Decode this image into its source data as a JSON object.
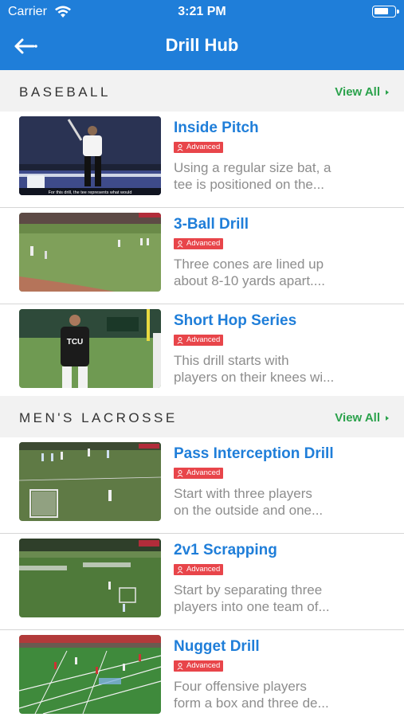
{
  "status": {
    "carrier": "Carrier",
    "time": "3:21 PM"
  },
  "nav": {
    "title": "Drill Hub"
  },
  "sections": [
    {
      "title": "BASEBALL",
      "view_all": "View All",
      "items": [
        {
          "title": "Inside Pitch",
          "badge": "Advanced",
          "desc_line1": "Using a regular size bat, a",
          "desc_line2": "tee is positioned on the...",
          "caption": "For this drill, the tee represents what would"
        },
        {
          "title": "3-Ball Drill",
          "badge": "Advanced",
          "desc_line1": "Three cones are lined up",
          "desc_line2": "about 8-10 yards apart...."
        },
        {
          "title": "Short Hop Series",
          "badge": "Advanced",
          "desc_line1": "This drill starts with",
          "desc_line2": "players on their knees wi...",
          "shirt_text": "TCU"
        }
      ]
    },
    {
      "title": "MEN'S LACROSSE",
      "view_all": "View All",
      "items": [
        {
          "title": "Pass Interception Drill",
          "badge": "Advanced",
          "desc_line1": "Start with three players",
          "desc_line2": "on the outside and one..."
        },
        {
          "title": "2v1 Scrapping",
          "badge": "Advanced",
          "desc_line1": "Start by separating three",
          "desc_line2": "players into one team of..."
        },
        {
          "title": "Nugget Drill",
          "badge": "Advanced",
          "desc_line1": "Four offensive players",
          "desc_line2": "form a box and three de..."
        }
      ]
    }
  ],
  "colors": {
    "header": "#1f7ed9",
    "title": "#1f7ed9",
    "view_all": "#2ba24c",
    "badge": "#e8454a",
    "desc": "#8d8d8d"
  },
  "icons": {
    "back": "arrow-left-icon",
    "wifi": "wifi-icon",
    "battery": "battery-icon",
    "badge": "person-icon",
    "view_all": "caret-right-icon"
  }
}
